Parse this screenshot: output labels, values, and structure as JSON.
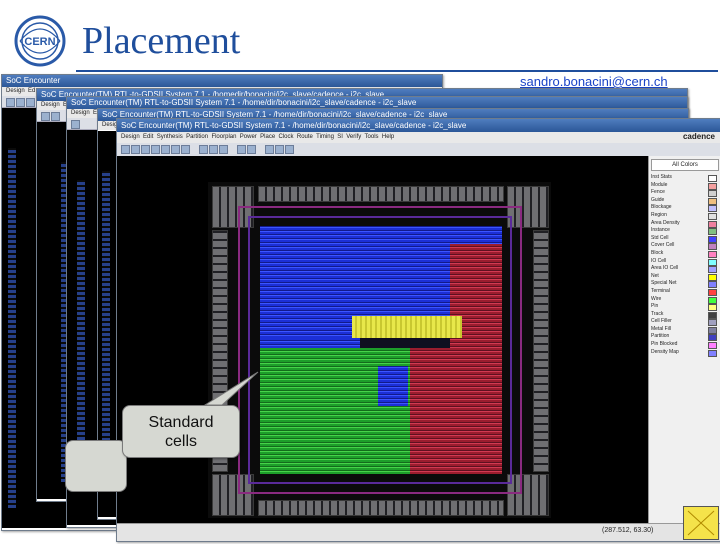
{
  "slide": {
    "title": "Placement",
    "email": "sandro.bonacini@cern.ch",
    "logo_text": "CERN"
  },
  "window": {
    "title": "SoC Encounter(TM) RTL-to-GDSII System 7.1 - /home/dir/bonacini/i2c_slave/cadence - i2c_slave",
    "title_short": "SoC Encounter(TM) RTL-to-GDSII System 7.1 - /homedir/bonacini/i2c_slave/cadence - i2c_slave",
    "title_partial": "SoC Encounter",
    "brand": "cadence",
    "menus": [
      "Design",
      "Edit",
      "Synthesis",
      "Partition",
      "Floorplan",
      "Power",
      "Place",
      "Clock",
      "Route",
      "Timing",
      "SI",
      "Verify",
      "Tools",
      "Help"
    ],
    "menu_partial": [
      "Design",
      "Ed"
    ],
    "status_coord": "(287.512, 63.30)"
  },
  "side_panel": {
    "header": "All Colors",
    "layers": [
      {
        "name": "Inst Stats",
        "color": "#ffffff"
      },
      {
        "name": "Module",
        "color": "#f4a0a0"
      },
      {
        "name": "Fence",
        "color": "#d0d0d0"
      },
      {
        "name": "Guide",
        "color": "#f0c080"
      },
      {
        "name": "Blockage",
        "color": "#c0c0ff"
      },
      {
        "name": "Region",
        "color": "#e0e0e0"
      },
      {
        "name": "Area Density",
        "color": "#f080a0"
      },
      {
        "name": "Instance",
        "color": "#80c080"
      },
      {
        "name": "Std Cell",
        "color": "#4040ff"
      },
      {
        "name": "Cover Cell",
        "color": "#c080c0"
      },
      {
        "name": "Block",
        "color": "#ff80c0"
      },
      {
        "name": "IO Cell",
        "color": "#80ffff"
      },
      {
        "name": "Area IO Cell",
        "color": "#a0a0ff"
      },
      {
        "name": "Net",
        "color": "#ffff00"
      },
      {
        "name": "Special Net",
        "color": "#8080ff"
      },
      {
        "name": "Terminal",
        "color": "#ff4040"
      },
      {
        "name": "Wire",
        "color": "#40ff40"
      },
      {
        "name": "Pin",
        "color": "#ffff80"
      },
      {
        "name": "Track",
        "color": "#404040"
      },
      {
        "name": "Cell Filler",
        "color": "#a0a0c0"
      },
      {
        "name": "Metal Fill",
        "color": "#8080a0"
      },
      {
        "name": "Partition",
        "color": "#4040c0"
      },
      {
        "name": "Pin Blocked",
        "color": "#ff80ff"
      },
      {
        "name": "Density Map",
        "color": "#8080ff"
      }
    ]
  },
  "callout": {
    "line1": "Standard",
    "line2": "cells"
  }
}
